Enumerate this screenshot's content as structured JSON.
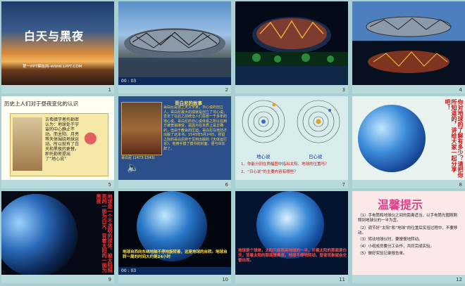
{
  "slides": [
    {
      "num": "1",
      "title": "白天与黑夜",
      "footer": "第一PPT模板网-WWW.1PPT.COM"
    },
    {
      "num": "2",
      "time": "00 : 03"
    },
    {
      "num": "3"
    },
    {
      "num": "4"
    },
    {
      "num": "5",
      "text": "历史上人们对于昼夜变化的认识",
      "scroll": "古希腊学者托勒密认为：地球处于宇宙的中心静止不动。而太阳、月亮等天体围绕地球运动。所以就有了白天和黑夜的更替。即托勒密提出了“地心说”"
    },
    {
      "num": "6",
      "title": "哥白尼的故事",
      "body": "哥白尼是波兰天文学家，日心说的创立人。哥白尼最大的成就是创立了日心说。否定了在此之前统治人们思想一千多年的地心说。哥白尼的日心说体系之所以在西方被普遍接受，是因为在本质上是正确的，但由于教会的压迫，哥白尼在死前才出版了这本书。1543年5月24日，弥留之际的哥白尼终于见到出版的《天体运行论》，他用手摸了摸书的封面，便与世长辞了。",
      "caption": "哥白尼 (1473-1543)"
    },
    {
      "num": "7",
      "label_left": "地心说",
      "label_right": "日心说",
      "q1": "1、你能分别在两幅图中指出太阳、地球的位置吗？",
      "q2": "2、“日心说”的主要内容有哪些？"
    },
    {
      "num": "8",
      "side": "你对地球的了解有多少？请把你所知道的，讲给大家一起分享吧！"
    },
    {
      "num": "9",
      "vert": "地球是一个不透明的球体，被太阳照亮的一面为白天，背着太阳的一面为黑夜"
    },
    {
      "num": "10",
      "time": "00 : 03",
      "caption": "地球自西向东绕地轴不停地旋转着，这是地球的自转。地球自转一周的时间大约是24小时"
    },
    {
      "num": "11",
      "caption": "地球是个球体，太阳只能照亮地球的一半，对着太阳的那面是白天，背着太阳的那面是黑夜。地球不停地转动，昼夜现象就会交替出现。"
    },
    {
      "num": "12",
      "title": "温馨提示",
      "tips": [
        "（1）手电筒和地球仪之间的距离适当，以手电筒光圈刚刚照到地球仪的一半为宜。",
        "（2）调节好“太阳”和“地球”的位置后实验过程中，不要移动。",
        "（3）转动地球仪时，要慢慢地转动。",
        "（4）小组成员要分工合作，共同完成实验。",
        "（5）做好实验记录报告单。"
      ]
    }
  ],
  "colors": {
    "accent": "#cc1111",
    "bg": "#a8d0d2"
  }
}
